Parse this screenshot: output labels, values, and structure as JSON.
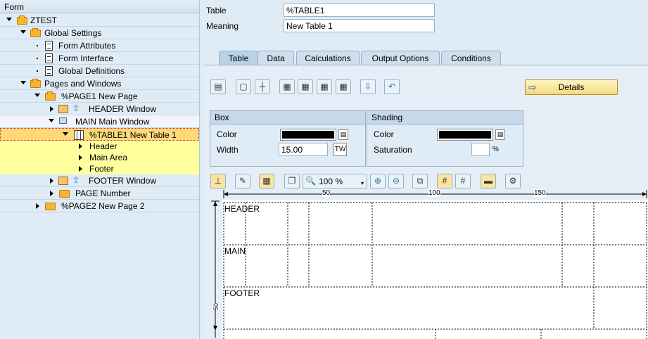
{
  "tree": {
    "header": "Form",
    "nodes": [
      {
        "label": "ZTEST"
      },
      {
        "label": "Global Settings"
      },
      {
        "label": "Form Attributes"
      },
      {
        "label": "Form Interface"
      },
      {
        "label": "Global Definitions"
      },
      {
        "label": "Pages and Windows"
      },
      {
        "label": "%PAGE1 New Page"
      },
      {
        "label": "HEADER Window"
      },
      {
        "label": "MAIN Main Window"
      },
      {
        "label": "%TABLE1 New Table 1"
      },
      {
        "label": "Header"
      },
      {
        "label": "Main Area"
      },
      {
        "label": "Footer"
      },
      {
        "label": "FOOTER Window"
      },
      {
        "label": "PAGE Number"
      },
      {
        "label": "%PAGE2 New Page 2"
      }
    ]
  },
  "top": {
    "table_label": "Table",
    "table_value": "%TABLE1",
    "meaning_label": "Meaning",
    "meaning_value": "New Table 1"
  },
  "tabs": [
    {
      "label": "Table",
      "active": true
    },
    {
      "label": "Data"
    },
    {
      "label": "Calculations"
    },
    {
      "label": "Output Options"
    },
    {
      "label": "Conditions"
    }
  ],
  "details_button": "Details",
  "box": {
    "title": "Box",
    "color_label": "Color",
    "width_label": "Width",
    "width_value": "15.00",
    "width_unit": "TW"
  },
  "shading": {
    "title": "Shading",
    "color_label": "Color",
    "saturation_label": "Saturation",
    "saturation_value": "",
    "saturation_unit": "%"
  },
  "zoom": "100 %",
  "ruler": {
    "t50": "50",
    "t100": "100",
    "t150": "150",
    "v50": "50"
  },
  "canvas": {
    "header": "HEADER",
    "main": "MAIN",
    "footer": "FOOTER"
  },
  "colors": {
    "accent": "#ffd87a",
    "selection": "#ffff9e",
    "panel": "#dfebf5"
  }
}
